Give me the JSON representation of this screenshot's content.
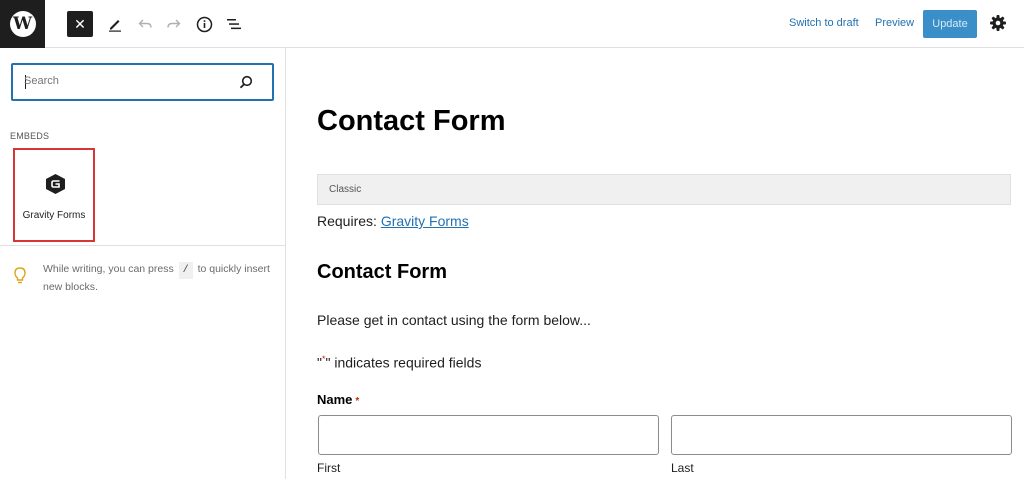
{
  "toolbar": {
    "logo_glyph": "W",
    "close_glyph": "✕",
    "switch_to_draft": "Switch to draft",
    "preview": "Preview",
    "update": "Update"
  },
  "icons": {
    "logo": "wordpress-logo",
    "close": "close-icon",
    "edit": "pencil-icon",
    "undo": "undo-icon",
    "redo": "redo-icon",
    "info": "info-icon",
    "list_view": "list-view-icon",
    "settings": "gear-icon",
    "search": "search-icon",
    "block": "gravity-forms-icon",
    "tip": "lightbulb-icon"
  },
  "inserter": {
    "search_placeholder": "Search",
    "category": "EMBEDS",
    "blocks": [
      {
        "label": "Gravity Forms"
      }
    ],
    "tip": {
      "before": "While writing, you can press",
      "key": "/",
      "after": "to quickly insert new blocks."
    }
  },
  "editor": {
    "title": "Contact Form",
    "classic_label": "Classic",
    "requires_label": "Requires:",
    "requires_link": "Gravity Forms",
    "heading": "Contact Form",
    "description": "Please get in contact using the form below...",
    "required_note_open": "\"",
    "required_note_star": "*",
    "required_note_rest": "\" indicates required fields",
    "name_label": "Name",
    "name_required_star": "*",
    "first_sublabel": "First",
    "last_sublabel": "Last"
  },
  "colors": {
    "accent": "#2271b1",
    "update_bg": "#3a8fc9",
    "highlight_border": "#d63638",
    "required": "#c02b0a",
    "dark": "#1e1e1e"
  }
}
